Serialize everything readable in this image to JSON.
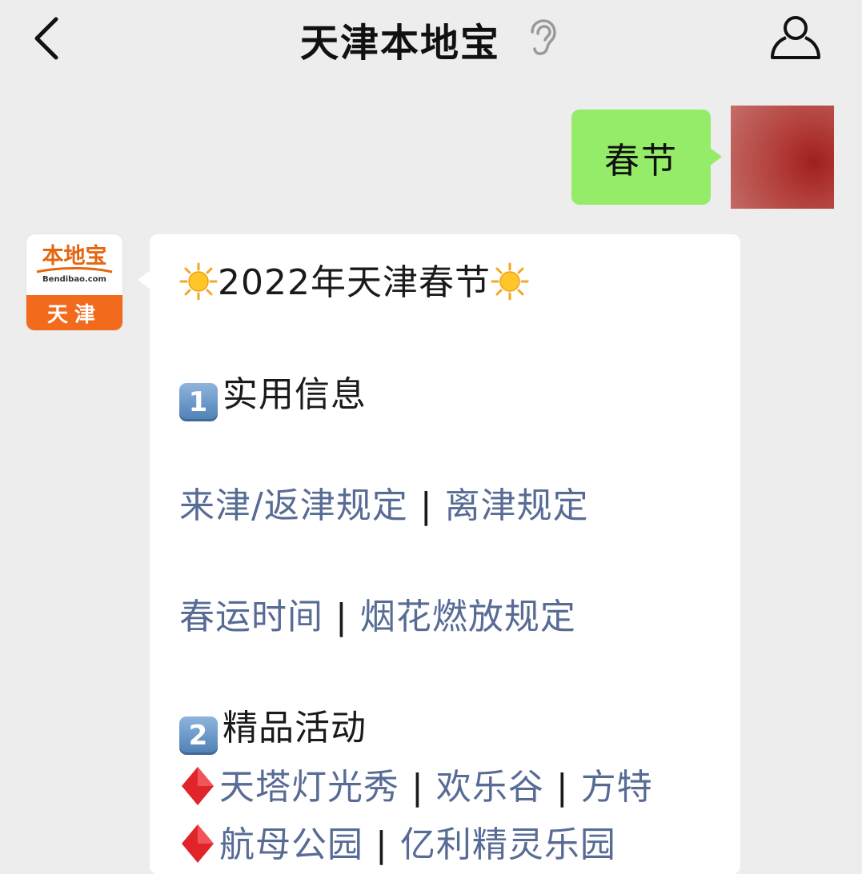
{
  "header": {
    "title": "天津本地宝",
    "back_icon": "chevron-left-icon",
    "ear_icon": "ear-icon",
    "profile_icon": "person-icon"
  },
  "outgoing": {
    "text": "春节",
    "bubble_color": "#95ec69"
  },
  "bot": {
    "avatar": {
      "logo_text": "本地宝",
      "logo_domain": "Bendibao.com",
      "city": "天津"
    },
    "message": {
      "title": "2022年天津春节",
      "section1": {
        "num": "1",
        "label": "实用信息"
      },
      "links_row1": [
        "来津/返津规定",
        "离津规定"
      ],
      "links_row2": [
        "春运时间",
        "烟花燃放规定"
      ],
      "section2": {
        "num": "2",
        "label": "精品活动"
      },
      "links_row3": [
        "天塔灯光秀",
        "欢乐谷",
        "方特"
      ],
      "links_row4": [
        "航母公园",
        "亿利精灵乐园"
      ],
      "separator": "|"
    }
  },
  "colors": {
    "background": "#ededed",
    "link": "#576b95",
    "logo_orange": "#f26a1b"
  }
}
